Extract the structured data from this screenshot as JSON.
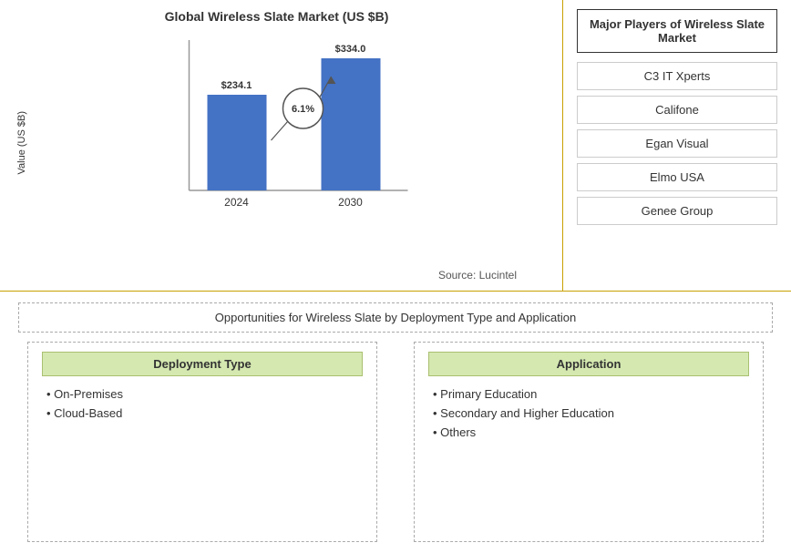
{
  "chart": {
    "title": "Global Wireless Slate Market (US $B)",
    "y_axis_label": "Value (US $B)",
    "source": "Source: Lucintel",
    "bars": [
      {
        "year": "2024",
        "value": 234.1,
        "label": "$234.1",
        "height_pct": 60
      },
      {
        "year": "2030",
        "value": 334.0,
        "label": "$334.0",
        "height_pct": 85
      }
    ],
    "cagr": "6.1%"
  },
  "major_players": {
    "title": "Major Players of Wireless Slate Market",
    "players": [
      "C3 IT Xperts",
      "Califone",
      "Egan Visual",
      "Elmo USA",
      "Genee Group"
    ]
  },
  "opportunities": {
    "title": "Opportunities for Wireless Slate by Deployment Type and Application",
    "deployment": {
      "header": "Deployment Type",
      "items": [
        "On-Premises",
        "Cloud-Based"
      ]
    },
    "application": {
      "header": "Application",
      "items": [
        "Primary Education",
        "Secondary and Higher Education",
        "Others"
      ]
    }
  }
}
